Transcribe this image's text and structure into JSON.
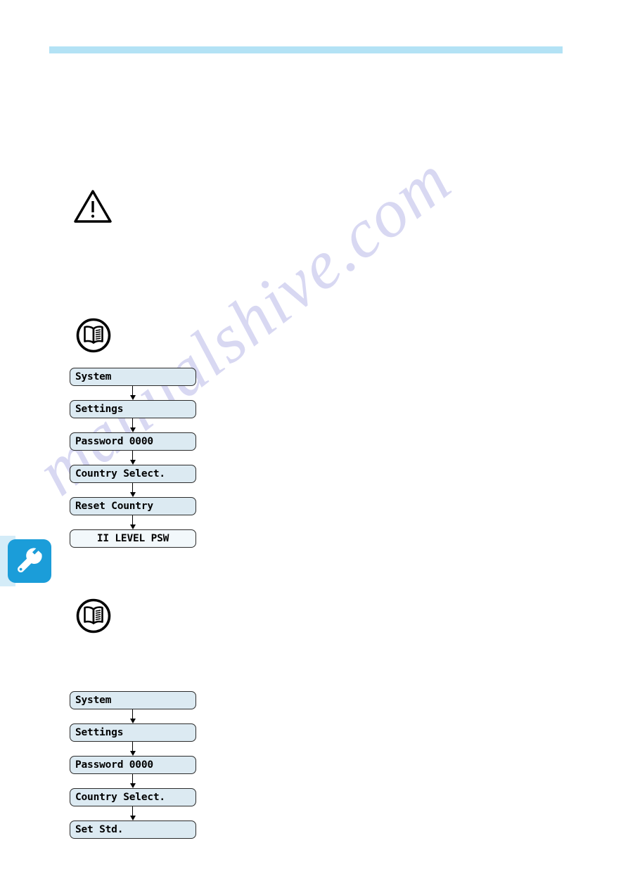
{
  "page": {
    "watermark": "manualshive.com",
    "header_rule_color": "#b3e2f5",
    "node_fill_color": "#dceaf2",
    "node_border_color": "#2b2b2b",
    "side_tab_color": "#1b9dd9"
  },
  "side_tab": {
    "icon": "wrench-icon"
  },
  "notes": {
    "warning_icon": "warning-triangle-icon",
    "book_icon_1": "open-book-icon",
    "book_icon_2": "open-book-icon"
  },
  "flowcharts": [
    {
      "name": "reset-country-flow",
      "nodes": [
        {
          "label": "System",
          "align": "left",
          "emphasis": false
        },
        {
          "label": "Settings",
          "align": "left",
          "emphasis": false
        },
        {
          "label": "Password 0000",
          "align": "left",
          "emphasis": false
        },
        {
          "label": "Country Select.",
          "align": "left",
          "emphasis": false
        },
        {
          "label": "Reset Country",
          "align": "left",
          "emphasis": false
        },
        {
          "label": "II LEVEL PSW",
          "align": "center",
          "emphasis": true
        }
      ]
    },
    {
      "name": "set-std-flow",
      "nodes": [
        {
          "label": "System",
          "align": "left",
          "emphasis": false
        },
        {
          "label": "Settings",
          "align": "left",
          "emphasis": false
        },
        {
          "label": "Password 0000",
          "align": "left",
          "emphasis": false
        },
        {
          "label": "Country Select.",
          "align": "left",
          "emphasis": false
        },
        {
          "label": "Set Std.",
          "align": "left",
          "emphasis": false
        }
      ]
    }
  ]
}
